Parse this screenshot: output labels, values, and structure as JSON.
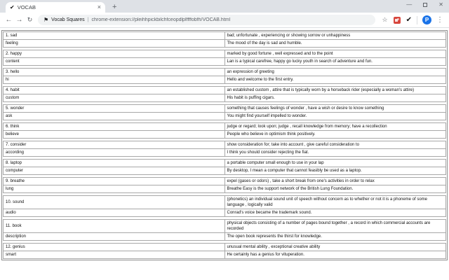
{
  "browser": {
    "tab": {
      "title": "VOCAB",
      "favicon": "✔",
      "close_label": "×"
    },
    "new_tab_label": "+",
    "window_controls": {
      "minimize": "—",
      "close": "✕"
    },
    "toolbar": {
      "back": "←",
      "forward": "→",
      "reload": "↻",
      "omnibox": {
        "page_icon": "⚑",
        "site_name": "Vocab Squares",
        "separator": "|",
        "url": "chrome-extension://pleihhpickbilchfceopdlplffffobfh/VOCAB.html"
      },
      "bookmark_star": "☆",
      "extension_check": "✔",
      "profile_initial": "P",
      "menu": "⋮"
    }
  },
  "colors": {
    "tabbar_bg": "#dee1e6",
    "omnibox_bg": "#f1f3f4",
    "avatar_blue": "#1a73e8",
    "extension_red": "#d7463d",
    "table_border": "#8f8f8f"
  },
  "page": {
    "entries": [
      {
        "word": "1. sad",
        "definition": "bad; unfortunate , experiencing or showing sorrow or unhappiness",
        "synonym": "feeling",
        "example": "The mood of the day is sad and humble."
      },
      {
        "word": "2. happy",
        "definition": "marked by good fortune , well expressed and to the point",
        "synonym": "content",
        "example": "Lan is a typical carefree, happy go lucky youth in search of adventure and fun."
      },
      {
        "word": "3. hello",
        "definition": "an expression of greeting",
        "synonym": "hi",
        "example": "Hello and welcome to the first entry."
      },
      {
        "word": "4. habit",
        "definition": "an established custom , attire that is typically worn by a horseback rider (especially a woman's attire)",
        "synonym": "custom",
        "example": "His habit is puffing cigars."
      },
      {
        "word": "5. wonder",
        "definition": "something that causes feelings of wonder , have a wish or desire to know something",
        "synonym": "ask",
        "example": "You might find yourself impelled to wonder."
      },
      {
        "word": "6. think",
        "definition": "judge or regard; look upon; judge , recall knowledge from memory; have a recollection",
        "synonym": "believe",
        "example": "People who believe in optimism think positively."
      },
      {
        "word": "7. consider",
        "definition": "show consideration for; take into account , give careful consideration to",
        "synonym": "according",
        "example": "I think you should consider rejecting the fiat."
      },
      {
        "word": "8. laptop",
        "definition": "a portable computer small enough to use in your lap",
        "synonym": "computer",
        "example": "By desktop, I mean a computer that cannot feasibly be used as a laptop."
      },
      {
        "word": "9. breathe",
        "definition": "expel (gases or odors) , take a short break from one's activities in order to relax",
        "synonym": "lung",
        "example": "Breathe Easy is the support network of the British Lung Foundation."
      },
      {
        "word": "10. sound",
        "definition": "(phonetics) an individual sound unit of speech without concern as to whether or not it is a phoneme of some language , logically valid",
        "synonym": "audio",
        "example": "Conrad's voice became the trademark sound."
      },
      {
        "word": "11. book",
        "definition": "physical objects consisting of a number of pages bound together , a record in which commercial accounts are recorded",
        "synonym": "description",
        "example": "The open book represents the thirst for knowledge."
      },
      {
        "word": "12. genius",
        "definition": "unusual mental ability , exceptional creative ability",
        "synonym": "smart",
        "example": "He certainly has a genius for vituperation."
      }
    ]
  }
}
